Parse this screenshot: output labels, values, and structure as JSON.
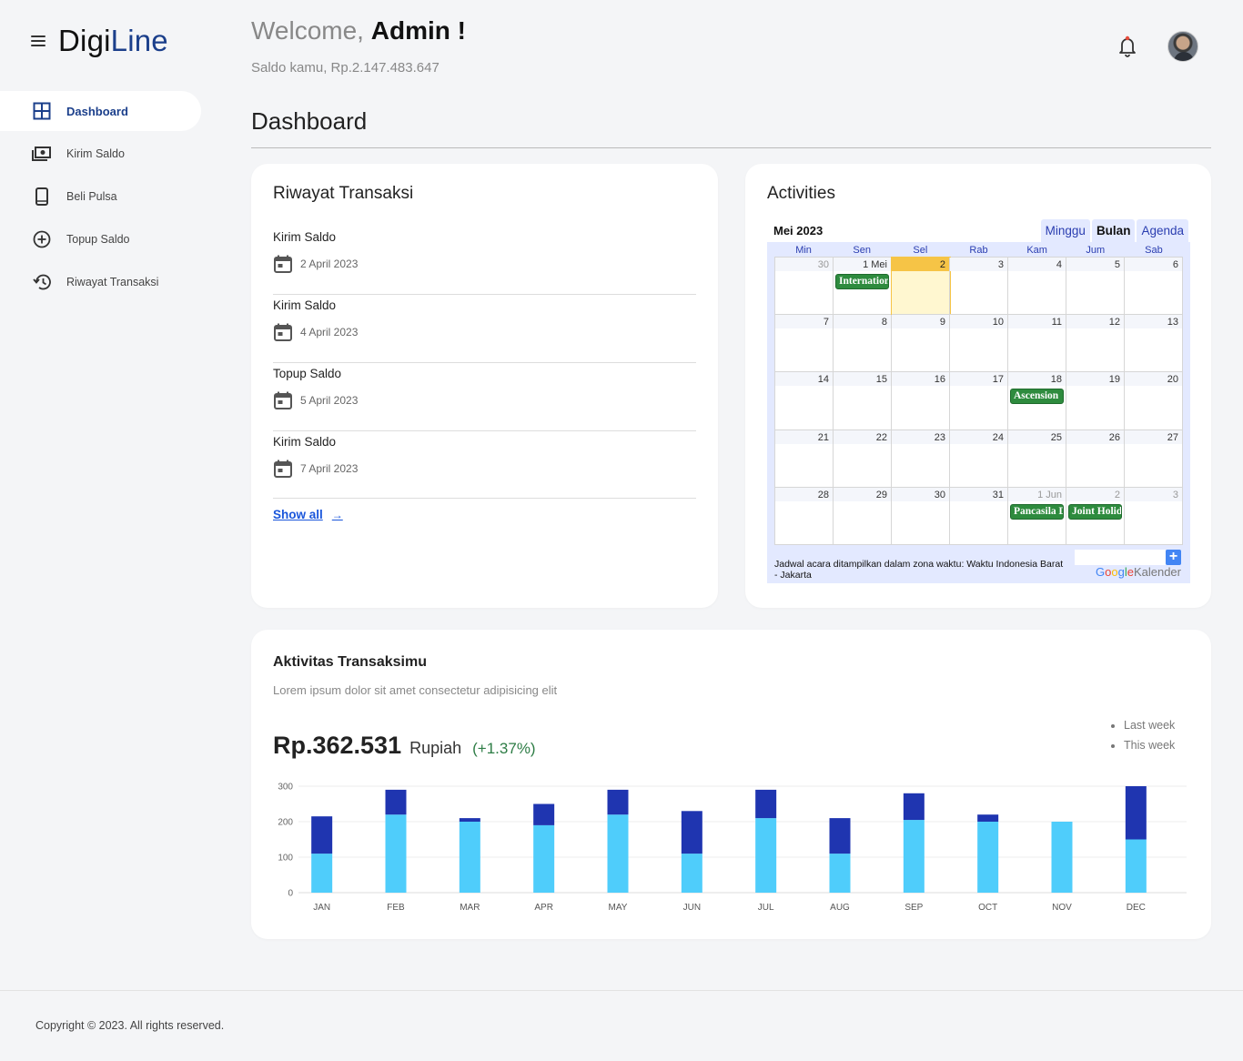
{
  "brand": {
    "prefix": "Digi",
    "accent": "Line"
  },
  "sidebar": {
    "items": [
      {
        "label": "Dashboard",
        "icon": "grid-icon",
        "active": true
      },
      {
        "label": "Kirim Saldo",
        "icon": "money-icon"
      },
      {
        "label": "Beli Pulsa",
        "icon": "phone-icon"
      },
      {
        "label": "Topup Saldo",
        "icon": "plus-circle-icon"
      },
      {
        "label": "Riwayat Transaksi",
        "icon": "history-icon"
      }
    ]
  },
  "header": {
    "welcome_prefix": "Welcome,",
    "welcome_name": "Admin !",
    "balance": "Saldo kamu, Rp.2.147.483.647"
  },
  "page": {
    "title": "Dashboard"
  },
  "transactions": {
    "title": "Riwayat Transaksi",
    "items": [
      {
        "name": "Kirim Saldo",
        "date": "2 April 2023"
      },
      {
        "name": "Kirim Saldo",
        "date": "4 April 2023"
      },
      {
        "name": "Topup Saldo",
        "date": "5 April 2023"
      },
      {
        "name": "Kirim Saldo",
        "date": "7 April 2023"
      }
    ],
    "show_all": "Show all",
    "arrow": "→"
  },
  "activities": {
    "title": "Activities",
    "calendar": {
      "month": "Mei 2023",
      "tabs": [
        "Minggu",
        "Bulan",
        "Agenda"
      ],
      "active_tab": "Bulan",
      "days": [
        "Min",
        "Sen",
        "Sel",
        "Rab",
        "Kam",
        "Jum",
        "Sab"
      ],
      "cells": [
        {
          "num": "30",
          "other": true
        },
        {
          "num": "1 Mei",
          "event": "International"
        },
        {
          "num": "2",
          "today": true
        },
        {
          "num": "3"
        },
        {
          "num": "4"
        },
        {
          "num": "5"
        },
        {
          "num": "6"
        },
        {
          "num": "7"
        },
        {
          "num": "8"
        },
        {
          "num": "9"
        },
        {
          "num": "10"
        },
        {
          "num": "11"
        },
        {
          "num": "12"
        },
        {
          "num": "13"
        },
        {
          "num": "14"
        },
        {
          "num": "15"
        },
        {
          "num": "16"
        },
        {
          "num": "17"
        },
        {
          "num": "18",
          "event": "Ascension"
        },
        {
          "num": "19"
        },
        {
          "num": "20"
        },
        {
          "num": "21"
        },
        {
          "num": "22"
        },
        {
          "num": "23"
        },
        {
          "num": "24"
        },
        {
          "num": "25"
        },
        {
          "num": "26"
        },
        {
          "num": "27"
        },
        {
          "num": "28"
        },
        {
          "num": "29"
        },
        {
          "num": "30"
        },
        {
          "num": "31"
        },
        {
          "num": "1 Jun",
          "other": true,
          "event": "Pancasila Day"
        },
        {
          "num": "2",
          "other": true,
          "event": "Joint Holiday"
        },
        {
          "num": "3",
          "other": true
        }
      ],
      "timezone_note": "Jadwal acara ditampilkan dalam zona waktu: Waktu Indonesia Barat - Jakarta",
      "brand_google": "Google",
      "brand_suffix": "Kalender",
      "add_label": "+"
    }
  },
  "activity_chart": {
    "title": "Aktivitas Transaksimu",
    "subtitle": "Lorem ipsum dolor sit amet consectetur adipisicing elit",
    "total": "Rp.362.531",
    "unit": "Rupiah",
    "delta": "(+1.37%)",
    "legend": [
      "Last week",
      "This week"
    ]
  },
  "chart_data": {
    "type": "bar",
    "stacked": true,
    "categories": [
      "JAN",
      "FEB",
      "MAR",
      "APR",
      "MAY",
      "JUN",
      "JUL",
      "AUG",
      "SEP",
      "OCT",
      "NOV",
      "DEC"
    ],
    "series": [
      {
        "name": "Last week",
        "color": "#4fcdfb",
        "values": [
          110,
          220,
          200,
          190,
          220,
          110,
          210,
          110,
          205,
          200,
          200,
          150
        ]
      },
      {
        "name": "This week",
        "color": "#1f35b0",
        "values": [
          105,
          70,
          10,
          60,
          70,
          120,
          80,
          100,
          75,
          20,
          0,
          150
        ]
      }
    ],
    "ylim": [
      0,
      300
    ],
    "yticks": [
      0,
      100,
      200,
      300
    ],
    "grid": true,
    "legend_position": "top-right"
  },
  "footer": {
    "copyright": "Copyright © 2023. All rights reserved."
  },
  "colors": {
    "brand": "#1b3f8b",
    "link": "#1a56db",
    "positive": "#2e7d46"
  }
}
